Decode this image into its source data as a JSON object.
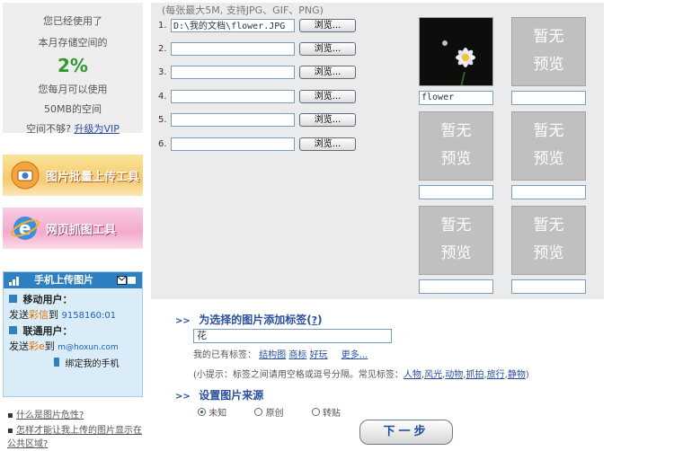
{
  "storage": {
    "line1": "您已经使用了",
    "line2": "本月存储空间的",
    "percent": "2%",
    "line3": "您每月可以使用",
    "line4": "50MB的空间",
    "space_prefix": "空间不够?",
    "upgrade_link": "升级为VIP"
  },
  "tools": {
    "batch_upload": "图片批量上传工具",
    "web_grab": "网页抓图工具"
  },
  "mobile": {
    "title": "手机上传图片",
    "mobile_users_label": "移动用户：",
    "mobile_send_prefix": "发送",
    "mobile_mms": "彩信",
    "mobile_to": "到",
    "mobile_number": "9158160:01",
    "unicom_users_label": "联通用户：",
    "unicom_send_prefix": "发送",
    "unicom_mms": "彩e",
    "unicom_to": "到",
    "unicom_address": "m@hoxun.com",
    "bind_phone": "绑定我的手机"
  },
  "faq": {
    "q1": "什么是图片危性?",
    "q2": "怎样才能让我上传的图片显示在公共区域?"
  },
  "upload": {
    "limit_note": "(每张最大5M, 支持JPG、GIF、PNG)",
    "browse_label": "浏览...",
    "rows": [
      {
        "num": "1.",
        "value": "D:\\我的文档\\flower.JPG"
      },
      {
        "num": "2.",
        "value": ""
      },
      {
        "num": "3.",
        "value": ""
      },
      {
        "num": "4.",
        "value": ""
      },
      {
        "num": "5.",
        "value": ""
      },
      {
        "num": "6.",
        "value": ""
      }
    ]
  },
  "previews": {
    "no_preview_line1": "暂无",
    "no_preview_line2": "预览",
    "caption_1": "flower"
  },
  "tags": {
    "title": "为选择的图片添加标签",
    "help": "?",
    "paren_open": "(",
    "paren_close": ")",
    "input_value": "花",
    "existing_label": "我的已有标签：",
    "existing": [
      "结构图",
      "商标",
      "好玩"
    ],
    "more": "更多...",
    "tip_prefix": "(小提示：标签之间请用空格或逗号分隔。常见标签：",
    "common": [
      "人物",
      "风光",
      "动物",
      "抓拍",
      "旅行",
      "静物"
    ],
    "tip_suffix": ")"
  },
  "source": {
    "title": "设置图片来源",
    "options": [
      "未知",
      "原创",
      "转贴"
    ],
    "selected": "未知"
  },
  "next_button": "下一步",
  "colors": {
    "accent_blue": "#2a4fa0",
    "percent_green": "#2e9a2e",
    "panel_gray": "#ebebeb"
  }
}
